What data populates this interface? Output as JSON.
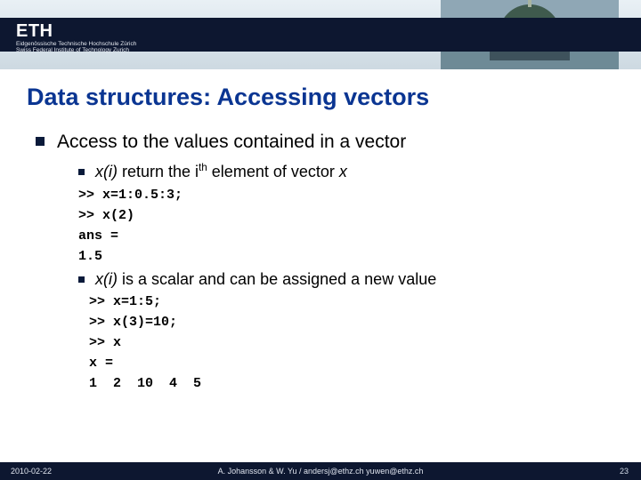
{
  "header": {
    "logo_main": "ETH",
    "logo_sub1": "Eidgenössische Technische Hochschule Zürich",
    "logo_sub2": "Swiss Federal Institute of Technology Zurich"
  },
  "title": "Data structures: Accessing vectors",
  "body": {
    "point1": "Access to the values contained in a vector",
    "sub1_pre": "x(i)",
    "sub1_mid": " return the i",
    "sub1_sup": "th",
    "sub1_post": " element of vector ",
    "sub1_tail": "x",
    "code1": ">> x=1:0.5:3;",
    "code2": ">> x(2)",
    "code3": "ans =",
    "code4": "1.5",
    "sub2_pre": "x(i)",
    "sub2_post": " is a scalar and can be assigned a new value",
    "code5": ">> x=1:5;",
    "code6": ">> x(3)=10;",
    "code7": ">> x",
    "code8": "x =",
    "code9": "1  2  10  4  5"
  },
  "footer": {
    "date": "2010-02-22",
    "center": "A. Johansson & W. Yu / andersj@ethz.ch  yuwen@ethz.ch",
    "page": "23"
  }
}
